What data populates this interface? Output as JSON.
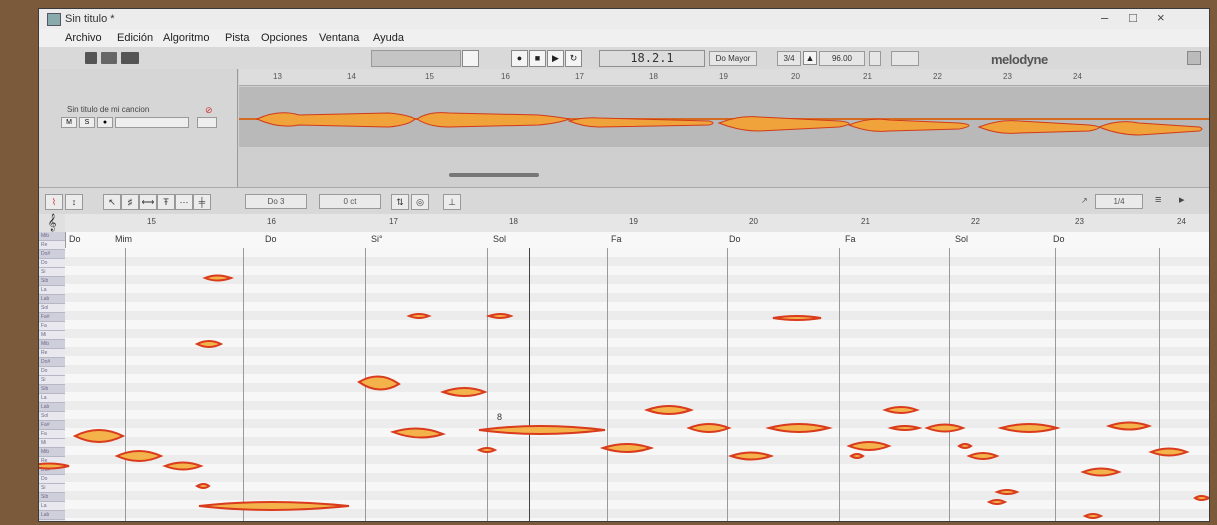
{
  "window": {
    "title": "Sin titulo *",
    "controls": [
      "–",
      "□",
      "×"
    ]
  },
  "menu": {
    "items": [
      "Archivo",
      "Edición",
      "Algoritmo",
      "Pista",
      "Opciones",
      "Ventana",
      "Ayuda"
    ]
  },
  "transport": {
    "position": "18.2.1",
    "key": "Do Mayor",
    "meter": "3/4",
    "tempo": "96.00",
    "logo": "melodyne"
  },
  "arrangement": {
    "track_name": "Sin titulo de mi cancion",
    "track_buttons": [
      "M",
      "S",
      "●"
    ],
    "ruler_bars": [
      "13",
      "14",
      "15",
      "16",
      "17",
      "18",
      "19",
      "20",
      "21",
      "22",
      "23",
      "24"
    ]
  },
  "editor_toolbar": {
    "field_1": "Do 3",
    "field_2": "0 ct",
    "zoom_value": "1/4"
  },
  "editor": {
    "clef_glyph": "𝄞",
    "ruler_bars": [
      "15",
      "16",
      "17",
      "18",
      "19",
      "20",
      "21",
      "22",
      "23",
      "24"
    ],
    "chords": [
      "Do",
      "Mim",
      "Do",
      "Si°",
      "Sol",
      "Fa",
      "Do",
      "Fa",
      "Sol",
      "Do"
    ],
    "annotation": "8",
    "key_labels": [
      "Mib",
      "Re",
      "Do#",
      "Do",
      "Si",
      "Sib",
      "La",
      "Lab",
      "Sol",
      "Fa#",
      "Fa",
      "Mi",
      "Mib",
      "Re",
      "Do#",
      "Do",
      "Si",
      "Sib",
      "La",
      "Lab",
      "Sol",
      "Fa#",
      "Fa",
      "Mi",
      "Mib",
      "Re",
      "Do#",
      "Do",
      "Si",
      "Sib",
      "La",
      "Lab",
      "Sol",
      "Fa#",
      "Fa"
    ]
  },
  "colors": {
    "blob_fill": "#f4b24a",
    "blob_edge": "#d93b1c"
  }
}
